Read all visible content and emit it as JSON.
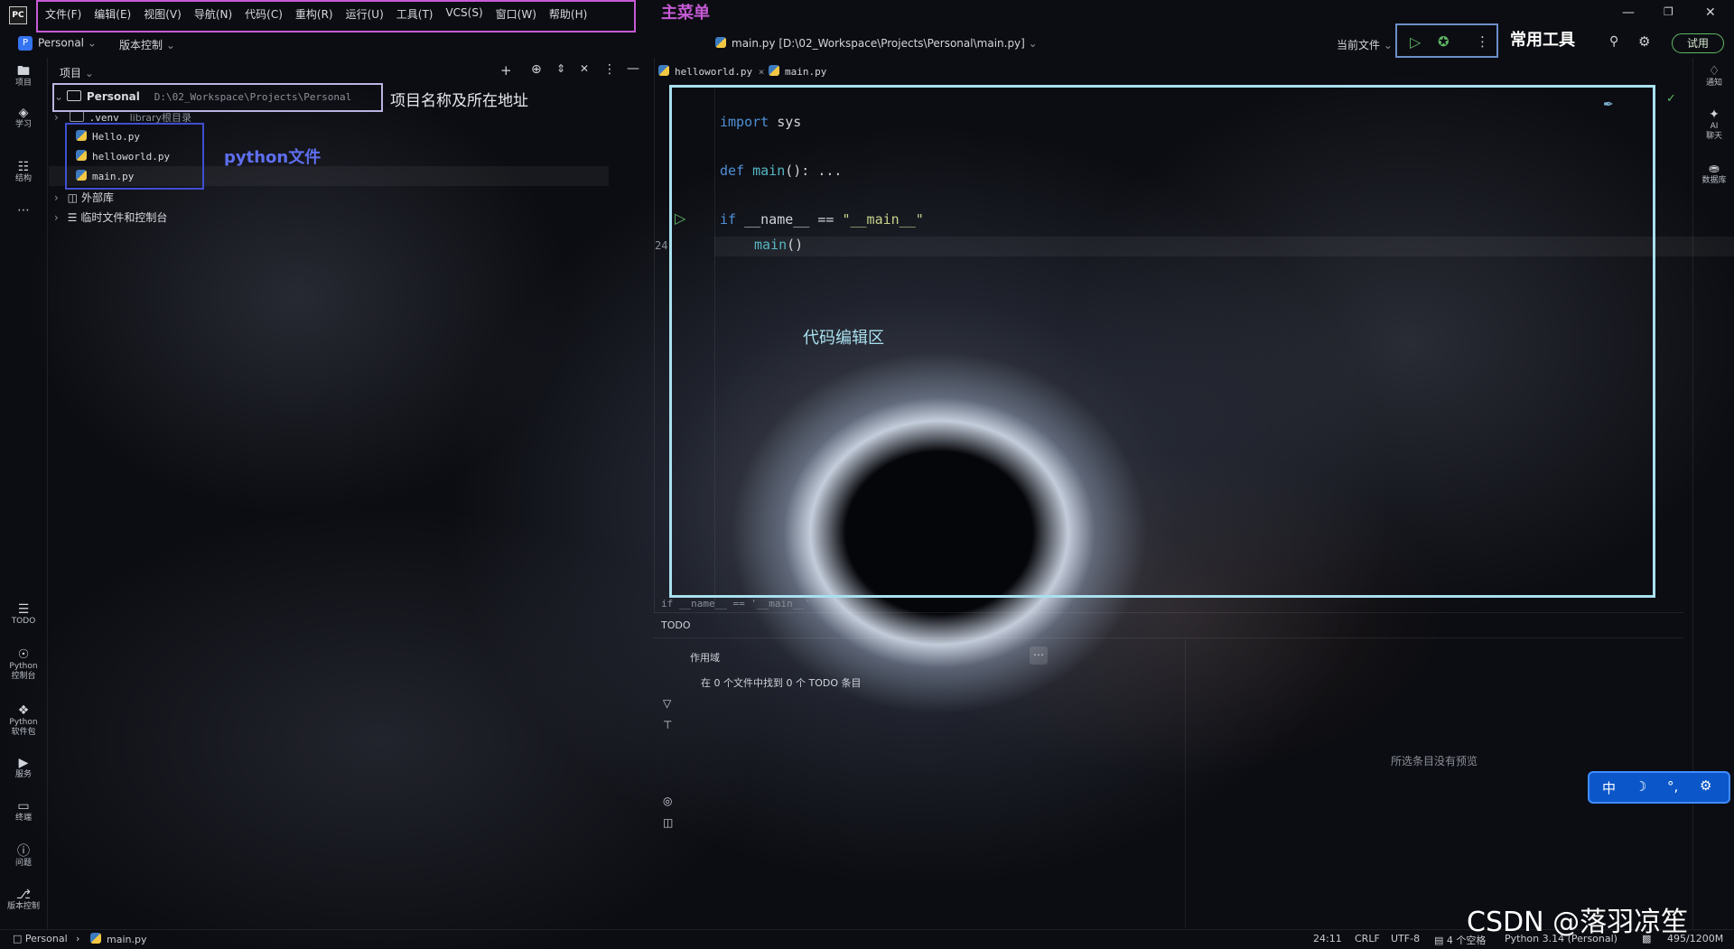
{
  "app": {
    "logo": "PC"
  },
  "menu": [
    "文件(F)",
    "编辑(E)",
    "视图(V)",
    "导航(N)",
    "代码(C)",
    "重构(R)",
    "运行(U)",
    "工具(T)",
    "VCS(S)",
    "窗口(W)",
    "帮助(H)"
  ],
  "toolbar": {
    "project": "Personal",
    "vcs": "版本控制",
    "file_path": "main.py [D:\\02_Workspace\\Projects\\Personal\\main.py]",
    "run_config": "当前文件",
    "trial": "试用"
  },
  "left_bar": {
    "top": [
      {
        "icon": "folder-icon",
        "label": "项目"
      },
      {
        "icon": "learn-icon",
        "label": "学习"
      },
      {
        "icon": "structure-icon",
        "label": "结构"
      }
    ],
    "bottom": [
      {
        "icon": "todo-icon",
        "label": "TODO"
      },
      {
        "icon": "python-console-icon",
        "label": "Python\n控制台"
      },
      {
        "icon": "python-packages-icon",
        "label": "Python\n软件包"
      },
      {
        "icon": "services-icon",
        "label": "服务"
      },
      {
        "icon": "terminal-icon",
        "label": "终端"
      },
      {
        "icon": "problems-icon",
        "label": "问题"
      },
      {
        "icon": "vcs-icon",
        "label": "版本控制"
      }
    ]
  },
  "right_bar": [
    {
      "icon": "bell-icon",
      "label": "通知"
    },
    {
      "icon": "ai-icon",
      "label": "AI\n聊天"
    },
    {
      "icon": "database-icon",
      "label": "数据库"
    }
  ],
  "project_panel": {
    "title": "项目",
    "root": {
      "name": "Personal",
      "path": "D:\\02_Workspace\\Projects\\Personal"
    },
    "venv": {
      "name": ".venv",
      "note": "library根目录"
    },
    "files": [
      "Hello.py",
      "helloworld.py",
      "main.py"
    ],
    "external": "外部库",
    "scratches": "临时文件和控制台"
  },
  "editor": {
    "tabs": [
      "helloworld.py",
      "main.py"
    ],
    "line_number": "24",
    "lines": {
      "l1_kw": "import",
      "l1_rest": " sys",
      "l2_kw": "def",
      "l2_fn": "main",
      "l2_rest": "(): ...",
      "l3_kw": "if",
      "l3_mid": " __name__ == ",
      "l3_str": "\"__main__\"",
      "l4_fn": "main",
      "l4_rest": "()"
    }
  },
  "todo_panel": {
    "breadcrumb": "if __name__ == '__main__'",
    "tab": "TODO",
    "scope": "作用域",
    "summary": "在 0 个文件中找到 0 个 TODO 条目",
    "preview": "所选条目没有预览"
  },
  "annotations": {
    "main_menu": "主菜单",
    "tools": "常用工具",
    "project_name": "项目名称及所在地址",
    "python_files": "python文件",
    "editor_area": "代码编辑区"
  },
  "ime": [
    "中"
  ],
  "status": {
    "project": "Personal",
    "file": "main.py",
    "position": "24:11",
    "line_sep": "CRLF",
    "encoding": "UTF-8",
    "indent": "4 个空格",
    "interpreter": "Python 3.14 (Personal)",
    "memory": "495/1200M"
  },
  "watermark": "CSDN @落羽凉笙",
  "colors": {
    "menu_box": "#c65ad6",
    "tools_box": "#6c8fc9",
    "project_box": "#b8b6e0",
    "files_box": "#3f4fd0",
    "editor_box": "#a9e0ef",
    "ime_bg": "#0b57c9"
  }
}
